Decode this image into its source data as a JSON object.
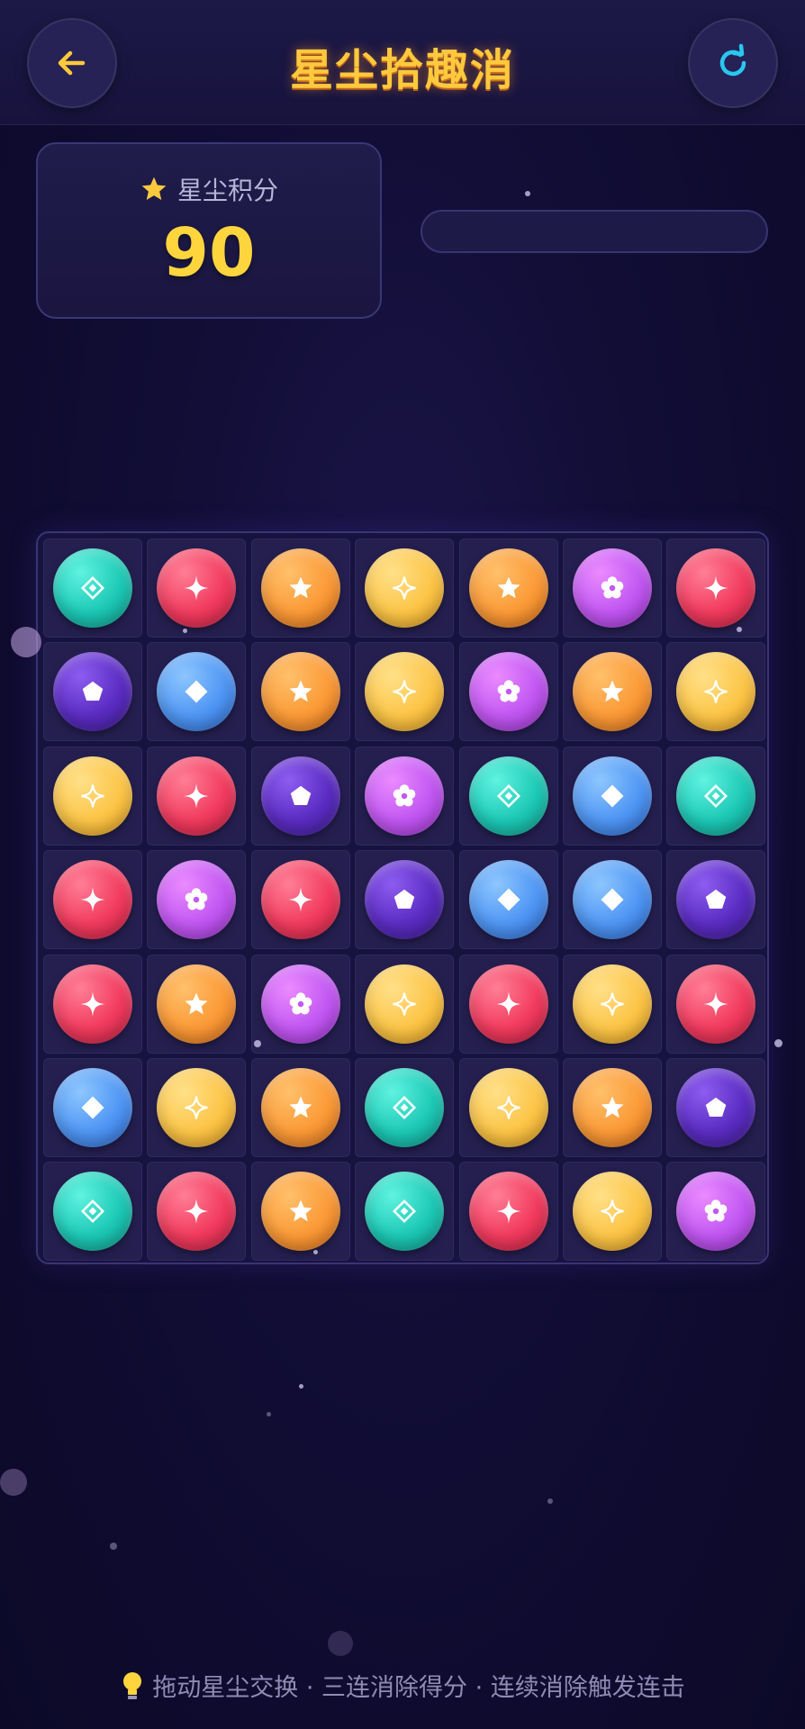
{
  "header": {
    "title": "星尘拾趣消",
    "back_icon": "arrow-left-icon",
    "refresh_icon": "refresh-icon",
    "accent_color": "#ffc93d",
    "refresh_color": "#28c8f0"
  },
  "score": {
    "label": "星尘积分",
    "value": "90",
    "icon": "star-icon"
  },
  "progress": {
    "fraction": 0
  },
  "board": {
    "rows": 7,
    "cols": 7,
    "grid": [
      [
        "teal",
        "red",
        "orange",
        "yellow",
        "orange",
        "pink",
        "red"
      ],
      [
        "purple",
        "blue",
        "orange",
        "yellow",
        "pink",
        "orange",
        "yellow"
      ],
      [
        "yellow",
        "red",
        "purple",
        "pink",
        "teal",
        "blue",
        "teal"
      ],
      [
        "red",
        "pink",
        "red",
        "purple",
        "blue",
        "blue",
        "purple"
      ],
      [
        "red",
        "orange",
        "pink",
        "yellow",
        "red",
        "yellow",
        "red"
      ],
      [
        "blue",
        "yellow",
        "orange",
        "teal",
        "yellow",
        "orange",
        "purple"
      ],
      [
        "teal",
        "red",
        "orange",
        "teal",
        "red",
        "yellow",
        "pink"
      ]
    ],
    "gem_icons": {
      "teal": "diamond-outline-icon",
      "red": "sparkle-icon",
      "orange": "star-icon",
      "yellow": "sparkle-outline-icon",
      "pink": "flower-icon",
      "purple": "pentagon-icon",
      "blue": "diamond-icon"
    }
  },
  "footer": {
    "icon": "lightbulb-icon",
    "hint": "拖动星尘交换 · 三连消除得分 · 连续消除触发连击"
  }
}
